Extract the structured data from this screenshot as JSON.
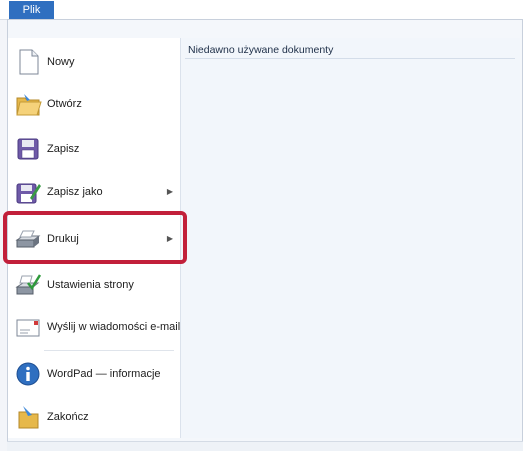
{
  "ribbon": {
    "file_tab": "Plik"
  },
  "menu": {
    "items": [
      {
        "label": "Nowy",
        "icon": "new-document-icon"
      },
      {
        "label": "Otwórz",
        "icon": "open-folder-icon"
      },
      {
        "label": "Zapisz",
        "icon": "save-disk-icon"
      },
      {
        "label": "Zapisz jako",
        "icon": "save-as-icon",
        "submenu": true
      },
      {
        "label": "Drukuj",
        "icon": "printer-icon",
        "submenu": true,
        "highlighted": true
      },
      {
        "label": "Ustawienia strony",
        "icon": "page-setup-icon"
      },
      {
        "label": "Wyślij w wiadomości e-mail",
        "icon": "email-icon"
      },
      {
        "label": "WordPad — informacje",
        "icon": "info-icon"
      },
      {
        "label": "Zakończ",
        "icon": "exit-icon"
      }
    ]
  },
  "recent": {
    "title": "Niedawno używane dokumenty"
  },
  "colors": {
    "accent": "#2f6fc0",
    "highlight": "#c2203a"
  }
}
